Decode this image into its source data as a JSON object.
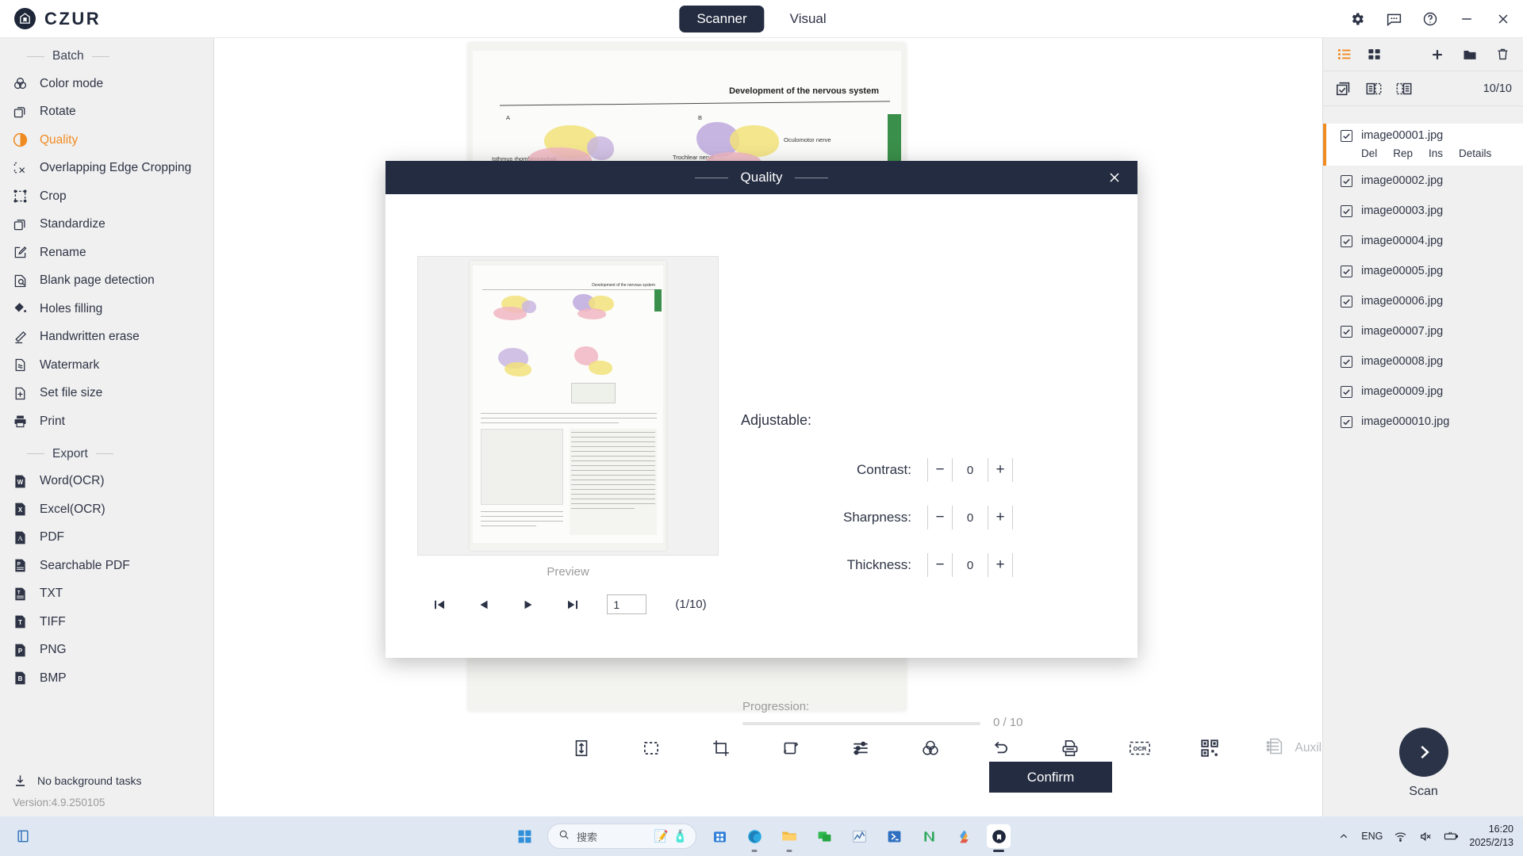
{
  "app": {
    "brand": "CZUR",
    "brand_icon": "czur-logo-icon",
    "version": "Version:4.9.250105"
  },
  "topnav": {
    "items": [
      {
        "label": "Scanner",
        "active": true
      },
      {
        "label": "Visual",
        "active": false
      }
    ],
    "controls": [
      {
        "name": "settings-gear-icon"
      },
      {
        "name": "feedback-chat-icon"
      },
      {
        "name": "help-question-icon"
      },
      {
        "name": "minimize-icon"
      },
      {
        "name": "close-icon"
      }
    ]
  },
  "sidebar": {
    "group_batch": "Batch",
    "group_export": "Export",
    "batch_items": [
      {
        "label": "Color mode",
        "icon": "color-mode-icon",
        "active": false
      },
      {
        "label": "Rotate",
        "icon": "rotate-icon",
        "active": false
      },
      {
        "label": "Quality",
        "icon": "quality-contrast-icon",
        "active": true
      },
      {
        "label": "Overlapping Edge Cropping",
        "icon": "overlap-crop-icon",
        "active": false
      },
      {
        "label": "Crop",
        "icon": "crop-icon",
        "active": false
      },
      {
        "label": "Standardize",
        "icon": "standardize-icon",
        "active": false
      },
      {
        "label": "Rename",
        "icon": "rename-pencil-icon",
        "active": false
      },
      {
        "label": "Blank page detection",
        "icon": "blank-page-detect-icon",
        "active": false
      },
      {
        "label": "Holes filling",
        "icon": "holes-filling-icon",
        "active": false
      },
      {
        "label": "Handwritten erase",
        "icon": "handwritten-erase-icon",
        "active": false
      },
      {
        "label": "Watermark",
        "icon": "watermark-icon",
        "active": false
      },
      {
        "label": "Set file size",
        "icon": "set-file-size-icon",
        "active": false
      },
      {
        "label": "Print",
        "icon": "printer-icon",
        "active": false
      }
    ],
    "export_items": [
      {
        "label": "Word(OCR)",
        "icon": "word-file-icon",
        "glyph": "W"
      },
      {
        "label": "Excel(OCR)",
        "icon": "excel-file-icon",
        "glyph": "X"
      },
      {
        "label": "PDF",
        "icon": "pdf-file-icon",
        "glyph": "A"
      },
      {
        "label": "Searchable PDF",
        "icon": "searchable-pdf-icon",
        "glyph": "P"
      },
      {
        "label": "TXT",
        "icon": "txt-file-icon",
        "glyph": "T"
      },
      {
        "label": "TIFF",
        "icon": "tiff-file-icon",
        "glyph": "T"
      },
      {
        "label": "PNG",
        "icon": "png-file-icon",
        "glyph": "P"
      },
      {
        "label": "BMP",
        "icon": "bmp-file-icon",
        "glyph": "B"
      }
    ],
    "background_task": "No background tasks",
    "background_task_icon": "download-tray-icon"
  },
  "canvas": {
    "document_title": "Development of the nervous system",
    "labels": [
      "A",
      "B",
      "Isthmus rhombencephali",
      "Oculomotor nerve",
      "Trochlear nerve"
    ]
  },
  "bottom_toolbar": {
    "buttons": [
      {
        "name": "fit-height-icon",
        "label": "Fit height"
      },
      {
        "name": "select-area-icon",
        "label": "Select area"
      },
      {
        "name": "crop-icon",
        "label": "Crop"
      },
      {
        "name": "rotate-icon",
        "label": "Rotate"
      },
      {
        "name": "adjust-sliders-icon",
        "label": "Adjust"
      },
      {
        "name": "color-mode-icon",
        "label": "Color mode"
      },
      {
        "name": "undo-icon",
        "label": "Undo"
      },
      {
        "name": "print-icon",
        "label": "Print"
      },
      {
        "name": "ocr-icon",
        "label": "OCR"
      },
      {
        "name": "qrcode-icon",
        "label": "QR code"
      }
    ],
    "auxiliary_correction": "Auxiliary correction",
    "auxiliary_icon": "auxiliary-correction-icon",
    "auxiliary_disabled": true
  },
  "right_panel": {
    "view_icons": [
      {
        "name": "list-view-icon",
        "active": true
      },
      {
        "name": "grid-view-icon",
        "active": false
      }
    ],
    "action_icons": [
      {
        "name": "add-icon"
      },
      {
        "name": "folder-icon"
      },
      {
        "name": "delete-trash-icon"
      }
    ],
    "select_icons": [
      {
        "name": "select-all-icon"
      },
      {
        "name": "select-odd-icon"
      },
      {
        "name": "select-even-icon"
      }
    ],
    "count": "10/10",
    "selected_index": 0,
    "row_actions": [
      "Del",
      "Rep",
      "Ins",
      "Details"
    ],
    "files": [
      {
        "name": "image00001.jpg",
        "checked": true
      },
      {
        "name": "image00002.jpg",
        "checked": true
      },
      {
        "name": "image00003.jpg",
        "checked": true
      },
      {
        "name": "image00004.jpg",
        "checked": true
      },
      {
        "name": "image00005.jpg",
        "checked": true
      },
      {
        "name": "image00006.jpg",
        "checked": true
      },
      {
        "name": "image00007.jpg",
        "checked": true
      },
      {
        "name": "image00008.jpg",
        "checked": true
      },
      {
        "name": "image00009.jpg",
        "checked": true
      },
      {
        "name": "image000010.jpg",
        "checked": true
      }
    ],
    "scan_label": "Scan",
    "scan_icon": "chevron-right-icon"
  },
  "modal": {
    "title": "Quality",
    "close_icon": "close-icon",
    "adjustable_label": "Adjustable:",
    "controls": [
      {
        "label": "Contrast:",
        "value": "0",
        "minus": "−",
        "plus": "+"
      },
      {
        "label": "Sharpness:",
        "value": "0",
        "minus": "−",
        "plus": "+"
      },
      {
        "label": "Thickness:",
        "value": "0",
        "minus": "−",
        "plus": "+"
      }
    ],
    "preview_label": "Preview",
    "nav": [
      {
        "name": "first-page-button"
      },
      {
        "name": "prev-page-button"
      },
      {
        "name": "next-page-button"
      },
      {
        "name": "last-page-button"
      }
    ],
    "page_value": "1",
    "page_count": "(1/10)",
    "progression_label": "Progression:",
    "progression_count": "0 / 10",
    "progression_percent": 0,
    "confirm_label": "Confirm"
  },
  "taskbar": {
    "start_icon": "windows-start-icon",
    "search_placeholder": "搜索",
    "search_icon": "search-icon",
    "apps": [
      {
        "name": "store-icon",
        "running": false
      },
      {
        "name": "edge-icon",
        "running": true
      },
      {
        "name": "file-explorer-icon",
        "running": true
      },
      {
        "name": "chat-green-icon",
        "running": false
      },
      {
        "name": "chart-app-icon",
        "running": false
      },
      {
        "name": "powershell-icon",
        "running": false
      },
      {
        "name": "n-app-icon",
        "running": false
      },
      {
        "name": "drive-app-icon",
        "running": false
      },
      {
        "name": "czur-app-icon",
        "running": true
      }
    ],
    "tray": [
      {
        "name": "chevron-up-icon"
      },
      {
        "name": "language-indicator",
        "label": "ENG"
      },
      {
        "name": "wifi-icon"
      },
      {
        "name": "volume-muted-icon"
      },
      {
        "name": "battery-charging-icon"
      }
    ],
    "time": "16:20",
    "date": "2025/2/13"
  },
  "colors": {
    "accent": "#f08b22",
    "dark": "#242c41",
    "sidebar_bg": "#f0f0f0",
    "taskbar_bg": "#dfe7f2"
  }
}
